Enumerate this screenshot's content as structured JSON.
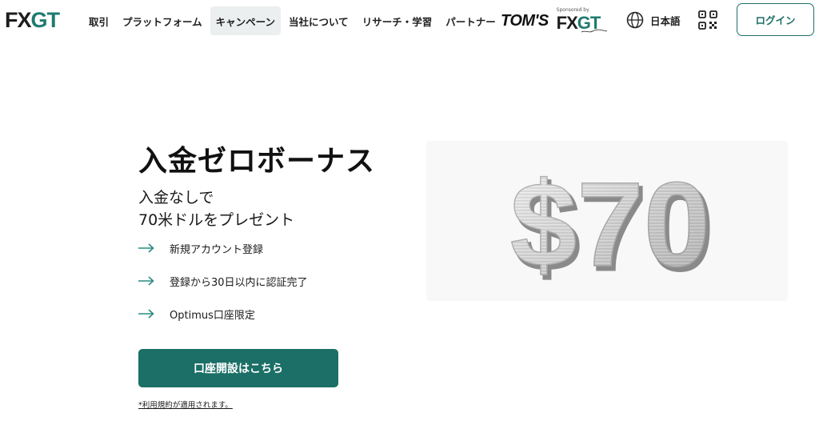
{
  "header": {
    "logo": {
      "fx": "FX",
      "gt": "GT"
    },
    "nav": [
      {
        "label": "取引"
      },
      {
        "label": "プラットフォーム"
      },
      {
        "label": "キャンペーン",
        "active": true
      },
      {
        "label": "当社について"
      },
      {
        "label": "リサーチ・学習"
      },
      {
        "label": "パートナー"
      }
    ],
    "sponsor": {
      "toms": "TOM'S",
      "caption": "Sponsored by",
      "fx": "FX",
      "gt": "GT"
    },
    "language": {
      "label": "日本語",
      "icon": "globe-icon"
    },
    "qr_icon": "qr-code-icon",
    "login_label": "ログイン"
  },
  "hero": {
    "title": "入金ゼロボーナス",
    "subtitle_line1": "入金なしで",
    "subtitle_line2": "70米ドルをプレゼント",
    "features": [
      {
        "text": "新規アカウント登録"
      },
      {
        "text": "登録から30日以内に認証完了"
      },
      {
        "text": "Optimus口座限定"
      }
    ],
    "cta_label": "口座開設はこちら",
    "terms_note": "*利用規約が適用されます。",
    "bonus_amount": "$70"
  },
  "colors": {
    "brand": "#1b6f67",
    "brand_light": "#1f7a6f",
    "arrow": "#2a8b80",
    "nav_active_bg": "#ecefef"
  }
}
